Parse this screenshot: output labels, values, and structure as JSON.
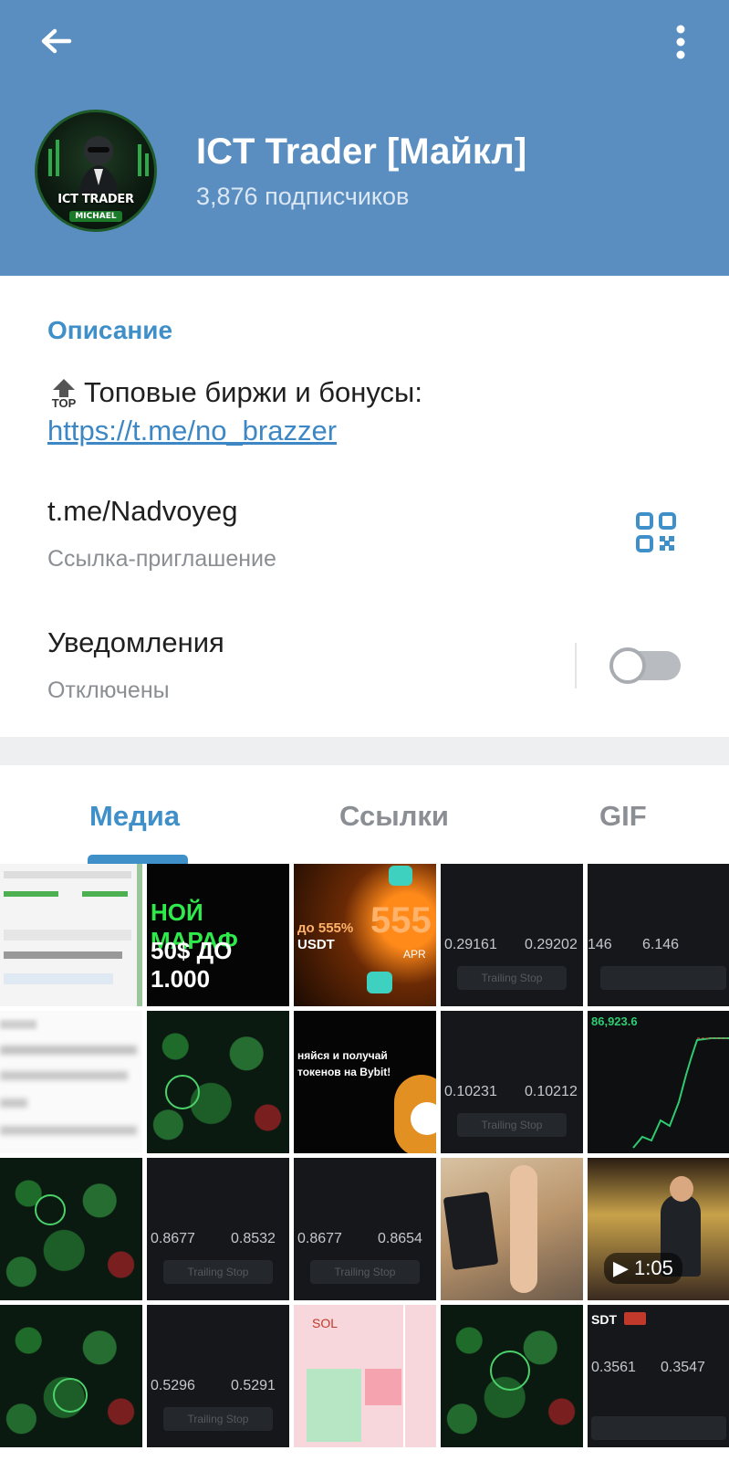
{
  "header": {
    "channel_title": "ICT Trader [Майкл]",
    "subscribers": "3,876 подписчиков",
    "avatar_title": "ICT TRADER",
    "avatar_subtitle": "MICHAEL",
    "background_color": "#5a8ec1"
  },
  "info": {
    "description_label": "Описание",
    "description_icon": "top-icon",
    "description_text": "Топовые биржи и бонусы:",
    "description_link": "https://t.me/no_brazzer",
    "invite_link": "t.me/Nadvoyeg",
    "invite_caption": "Ссылка-приглашение",
    "notifications_title": "Уведомления",
    "notifications_status": "Отключены",
    "notifications_enabled": false
  },
  "tabs": [
    "Медиа",
    "Ссылки",
    "GIF"
  ],
  "media": {
    "video_duration": "1:05",
    "trailing_stop": "Trailing Stop",
    "c1": {
      "price_a": "0.29161",
      "price_b": "0.29202"
    },
    "c2": {
      "price_a": "146",
      "price_b": "6.146"
    },
    "c3": {
      "price_a": "0.10231",
      "price_b": "0.10212"
    },
    "c4": {
      "price_a": "0.8677",
      "price_b": "0.8532"
    },
    "c5": {
      "price_a": "0.8677",
      "price_b": "0.8654"
    },
    "c6": {
      "price_a": "0.5296",
      "price_b": "0.5291"
    },
    "c7": {
      "price_a": "0.3561",
      "price_b": "0.3547"
    },
    "banner_1": "НОЙ МАРАФ",
    "banner_1b": "50$ ДО 1.000",
    "banner_2": "до 555%",
    "banner_2b": "USDT",
    "banner_2c": "555",
    "banner_2d": "APR",
    "chart_price": "86,923.6",
    "bybit_text": "няйся и получай токенов на Bybit!",
    "sol_label": "SOL",
    "usdt_label": "SDT"
  }
}
